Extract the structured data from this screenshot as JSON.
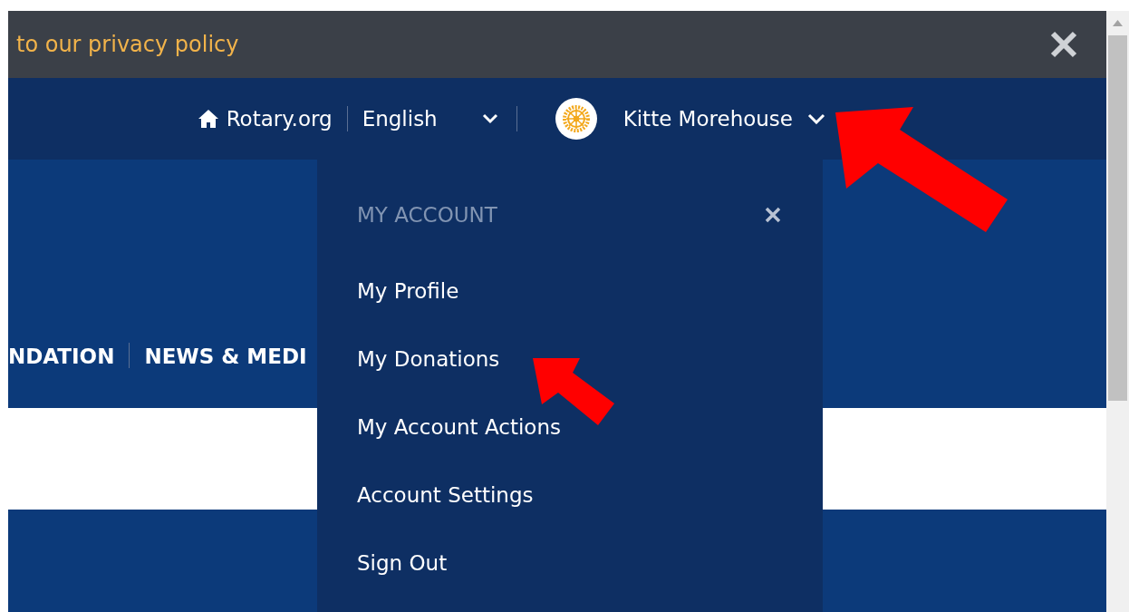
{
  "banner": {
    "text": "to our privacy policy"
  },
  "top_nav": {
    "home_link": "Rotary.org",
    "language": "English",
    "user_name": "Kitte Morehouse"
  },
  "main_nav": [
    {
      "label": "NDATION"
    },
    {
      "label": "NEWS & MEDI"
    }
  ],
  "account_menu": {
    "expanded": true,
    "title": "MY ACCOUNT",
    "items": [
      {
        "label": "My Profile"
      },
      {
        "label": "My Donations"
      },
      {
        "label": "My Account Actions"
      },
      {
        "label": "Account Settings"
      },
      {
        "label": "Sign Out"
      }
    ]
  }
}
